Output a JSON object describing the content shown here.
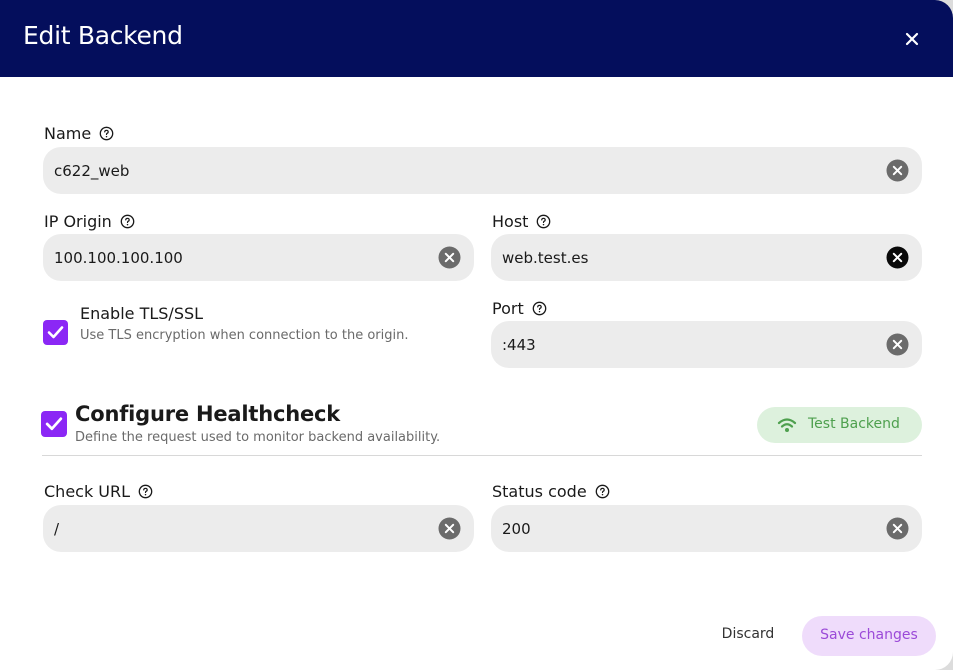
{
  "modal": {
    "title": "Edit Backend",
    "close_icon": "close-icon"
  },
  "fields": {
    "name": {
      "label": "Name",
      "value": "c622_web"
    },
    "ip_origin": {
      "label": "IP Origin",
      "value": "100.100.100.100"
    },
    "host": {
      "label": "Host",
      "value": "web.test.es"
    },
    "port": {
      "label": "Port",
      "value": ":443"
    },
    "check_url": {
      "label": "Check URL",
      "value": "/"
    },
    "status_code": {
      "label": "Status code",
      "value": "200"
    }
  },
  "tls": {
    "checked": true,
    "title": "Enable TLS/SSL",
    "description": "Use TLS encryption when connection to the origin."
  },
  "healthcheck": {
    "checked": true,
    "title": "Configure Healthcheck",
    "description": "Define the request used to monitor backend availability.",
    "test_button": "Test Backend"
  },
  "footer": {
    "discard": "Discard",
    "save": "Save changes"
  },
  "colors": {
    "header": "#040e5c",
    "accent": "#8b27f5",
    "test_button_bg": "#ddf1dd",
    "test_button_text": "#4ea04e",
    "save_button_bg": "#efdcfb",
    "save_button_text": "#9b4ad8",
    "field_bg": "#ececec"
  }
}
